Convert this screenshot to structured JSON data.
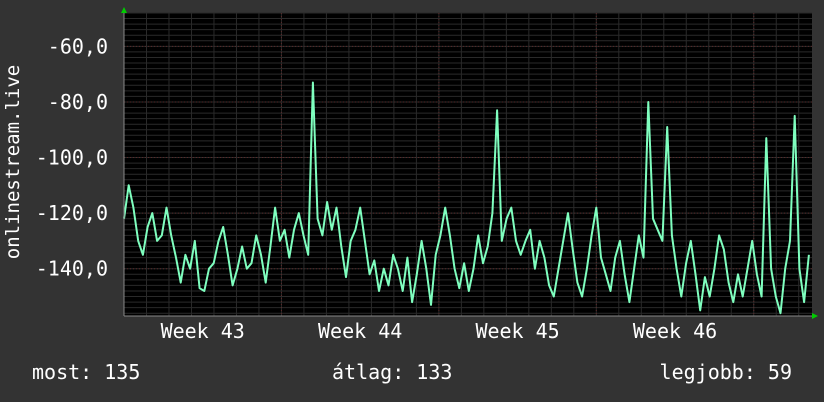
{
  "chart_data": {
    "type": "line",
    "ylabel": "onlinestream.live",
    "x_tick_labels": [
      "Week 43",
      "Week 44",
      "Week 45",
      "Week 46"
    ],
    "y_tick_labels": [
      "-60,0",
      "-80,0",
      "-100,0",
      "-120,0",
      "-140,0"
    ],
    "y_ticks": [
      -60,
      -80,
      -100,
      -120,
      -140
    ],
    "ylim": [
      -157,
      -48
    ],
    "xlim": [
      0,
      4.37
    ],
    "grid": true,
    "series": [
      {
        "color": "#7fffbf",
        "points": [
          [
            0.0,
            -122
          ],
          [
            0.03,
            -110
          ],
          [
            0.06,
            -118
          ],
          [
            0.09,
            -130
          ],
          [
            0.12,
            -135
          ],
          [
            0.15,
            -125
          ],
          [
            0.18,
            -120
          ],
          [
            0.21,
            -130
          ],
          [
            0.24,
            -128
          ],
          [
            0.27,
            -118
          ],
          [
            0.3,
            -128
          ],
          [
            0.33,
            -136
          ],
          [
            0.36,
            -145
          ],
          [
            0.39,
            -135
          ],
          [
            0.42,
            -140
          ],
          [
            0.45,
            -130
          ],
          [
            0.48,
            -147
          ],
          [
            0.51,
            -148
          ],
          [
            0.54,
            -140
          ],
          [
            0.57,
            -138
          ],
          [
            0.6,
            -130
          ],
          [
            0.63,
            -125
          ],
          [
            0.66,
            -135
          ],
          [
            0.69,
            -146
          ],
          [
            0.72,
            -140
          ],
          [
            0.75,
            -132
          ],
          [
            0.78,
            -140
          ],
          [
            0.81,
            -138
          ],
          [
            0.84,
            -128
          ],
          [
            0.87,
            -135
          ],
          [
            0.9,
            -145
          ],
          [
            0.93,
            -132
          ],
          [
            0.96,
            -118
          ],
          [
            0.99,
            -130
          ],
          [
            1.02,
            -126
          ],
          [
            1.05,
            -136
          ],
          [
            1.08,
            -126
          ],
          [
            1.11,
            -120
          ],
          [
            1.14,
            -128
          ],
          [
            1.17,
            -135
          ],
          [
            1.2,
            -73
          ],
          [
            1.23,
            -122
          ],
          [
            1.26,
            -128
          ],
          [
            1.29,
            -116
          ],
          [
            1.32,
            -126
          ],
          [
            1.35,
            -118
          ],
          [
            1.38,
            -132
          ],
          [
            1.41,
            -143
          ],
          [
            1.44,
            -130
          ],
          [
            1.47,
            -126
          ],
          [
            1.5,
            -118
          ],
          [
            1.53,
            -130
          ],
          [
            1.56,
            -142
          ],
          [
            1.59,
            -137
          ],
          [
            1.62,
            -148
          ],
          [
            1.65,
            -140
          ],
          [
            1.68,
            -146
          ],
          [
            1.71,
            -135
          ],
          [
            1.74,
            -140
          ],
          [
            1.77,
            -148
          ],
          [
            1.8,
            -136
          ],
          [
            1.83,
            -152
          ],
          [
            1.86,
            -142
          ],
          [
            1.89,
            -130
          ],
          [
            1.92,
            -140
          ],
          [
            1.95,
            -153
          ],
          [
            1.98,
            -135
          ],
          [
            2.01,
            -128
          ],
          [
            2.04,
            -118
          ],
          [
            2.07,
            -128
          ],
          [
            2.1,
            -140
          ],
          [
            2.13,
            -147
          ],
          [
            2.16,
            -138
          ],
          [
            2.19,
            -148
          ],
          [
            2.22,
            -140
          ],
          [
            2.25,
            -128
          ],
          [
            2.28,
            -138
          ],
          [
            2.31,
            -132
          ],
          [
            2.34,
            -120
          ],
          [
            2.37,
            -83
          ],
          [
            2.4,
            -130
          ],
          [
            2.43,
            -122
          ],
          [
            2.46,
            -118
          ],
          [
            2.49,
            -130
          ],
          [
            2.52,
            -135
          ],
          [
            2.55,
            -130
          ],
          [
            2.58,
            -126
          ],
          [
            2.61,
            -140
          ],
          [
            2.64,
            -130
          ],
          [
            2.67,
            -136
          ],
          [
            2.7,
            -146
          ],
          [
            2.73,
            -150
          ],
          [
            2.76,
            -140
          ],
          [
            2.79,
            -130
          ],
          [
            2.82,
            -120
          ],
          [
            2.85,
            -133
          ],
          [
            2.88,
            -145
          ],
          [
            2.91,
            -150
          ],
          [
            2.94,
            -140
          ],
          [
            2.97,
            -128
          ],
          [
            3.0,
            -118
          ],
          [
            3.03,
            -136
          ],
          [
            3.06,
            -142
          ],
          [
            3.09,
            -148
          ],
          [
            3.12,
            -136
          ],
          [
            3.15,
            -130
          ],
          [
            3.18,
            -142
          ],
          [
            3.21,
            -152
          ],
          [
            3.24,
            -140
          ],
          [
            3.27,
            -128
          ],
          [
            3.3,
            -136
          ],
          [
            3.33,
            -80
          ],
          [
            3.36,
            -122
          ],
          [
            3.39,
            -126
          ],
          [
            3.42,
            -130
          ],
          [
            3.45,
            -89
          ],
          [
            3.48,
            -128
          ],
          [
            3.51,
            -140
          ],
          [
            3.54,
            -150
          ],
          [
            3.57,
            -138
          ],
          [
            3.6,
            -130
          ],
          [
            3.63,
            -142
          ],
          [
            3.66,
            -155
          ],
          [
            3.69,
            -143
          ],
          [
            3.72,
            -150
          ],
          [
            3.75,
            -140
          ],
          [
            3.78,
            -128
          ],
          [
            3.81,
            -133
          ],
          [
            3.84,
            -145
          ],
          [
            3.87,
            -152
          ],
          [
            3.9,
            -142
          ],
          [
            3.93,
            -150
          ],
          [
            3.96,
            -140
          ],
          [
            3.99,
            -130
          ],
          [
            4.02,
            -142
          ],
          [
            4.05,
            -150
          ],
          [
            4.08,
            -93
          ],
          [
            4.11,
            -140
          ],
          [
            4.14,
            -150
          ],
          [
            4.17,
            -156
          ],
          [
            4.2,
            -140
          ],
          [
            4.23,
            -130
          ],
          [
            4.26,
            -85
          ],
          [
            4.29,
            -140
          ],
          [
            4.32,
            -152
          ],
          [
            4.35,
            -135
          ]
        ]
      }
    ]
  },
  "stats": {
    "most": "most: 135",
    "avg": "átlag: 133",
    "best": "legjobb: 59"
  }
}
